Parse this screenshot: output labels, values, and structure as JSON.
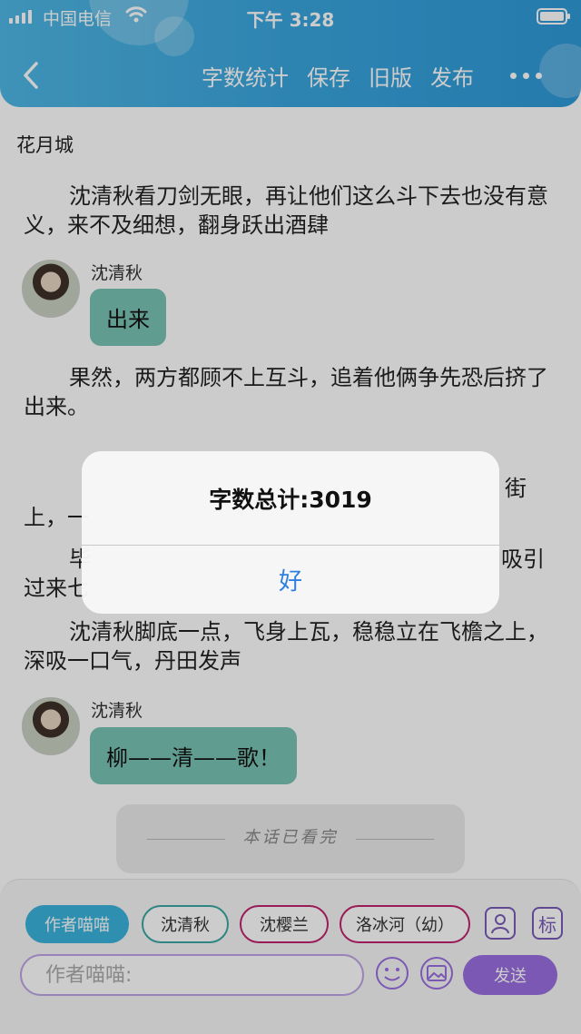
{
  "status_bar": {
    "carrier": "中国电信",
    "time": "下午 3:28"
  },
  "header": {
    "back_icon": "chevron-left-icon",
    "nav": [
      "字数统计",
      "保存",
      "旧版",
      "发布"
    ],
    "more_icon": "more-dots-icon",
    "gradient": [
      "#4fb8e6",
      "#2e9ad8"
    ]
  },
  "content": {
    "title": "花月城",
    "paragraph_1": "沈清秋看刀剑无眼，再让他们这么斗下去也没有意义，来不及细想，翻身跃出酒肆",
    "dialogue_1": {
      "speaker": "沈清秋",
      "message": "出来"
    },
    "paragraph_2": "果然，两方都顾不上互斗，追着他俩争先恐后挤了出来。",
    "paragraph_3_left": "上，一",
    "paragraph_3_right": "街",
    "paragraph_4_left_a": "毕",
    "paragraph_4_left_b": "过来七",
    "paragraph_4_right": "吸引",
    "paragraph_5": "沈清秋脚底一点，飞身上瓦，稳稳立在飞檐之上，深吸一口气，丹田发声",
    "dialogue_2": {
      "speaker": "沈清秋",
      "message": "柳——清——歌！"
    },
    "end_note": "本话已看完"
  },
  "bottom_bar": {
    "roles": [
      "作者喵喵",
      "沈清秋",
      "沈樱兰",
      "洛冰河（幼）"
    ],
    "role_icon": "character-icon",
    "mark_label": "标",
    "input_placeholder": "作者喵喵:",
    "emoji_icon": "emoji-icon",
    "image_icon": "image-icon",
    "send_label": "发送"
  },
  "dialog": {
    "title": "字数总计:3019",
    "ok_label": "好"
  },
  "colors": {
    "accent_blue": "#3ab3dc",
    "message_bubble": "#7ac3b5",
    "send_purple": "#9a6fe0",
    "dialog_button": "#2f7fe0"
  }
}
